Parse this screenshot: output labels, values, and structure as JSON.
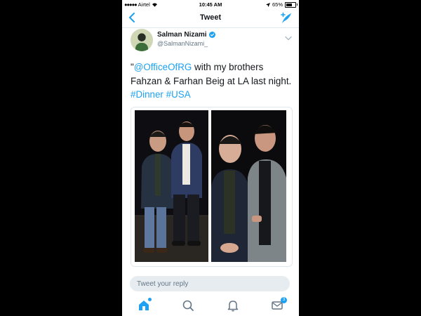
{
  "status_bar": {
    "carrier": "Airtel",
    "time": "10:45 AM",
    "battery": "65%",
    "battery_level": 0.65
  },
  "nav": {
    "title": "Tweet"
  },
  "tweet": {
    "author_name": "Salman Nizami",
    "author_handle": "@SalmanNizami_",
    "text": {
      "quote_mark": "\"",
      "mention": "@OfficeOfRG",
      "body": " with my brothers Fahzan & Farhan Beig at LA last night. ",
      "hashtag1": "#Dinner",
      "hashtag2": "#USA"
    }
  },
  "reply": {
    "placeholder": "Tweet your reply"
  },
  "tabs": {
    "messages_badge": "3"
  },
  "colors": {
    "accent": "#1da1f2",
    "text": "#14171a",
    "muted": "#657786",
    "divider": "#e1e8ed",
    "reply_bg": "#e6ecf0"
  },
  "icons": {
    "back": "chevron-left-icon",
    "compose": "compose-tweet-icon",
    "verified": "verified-badge-icon",
    "more": "chevron-down-icon",
    "home": "home-icon",
    "search": "search-icon",
    "notifications": "bell-icon",
    "messages": "envelope-icon"
  }
}
